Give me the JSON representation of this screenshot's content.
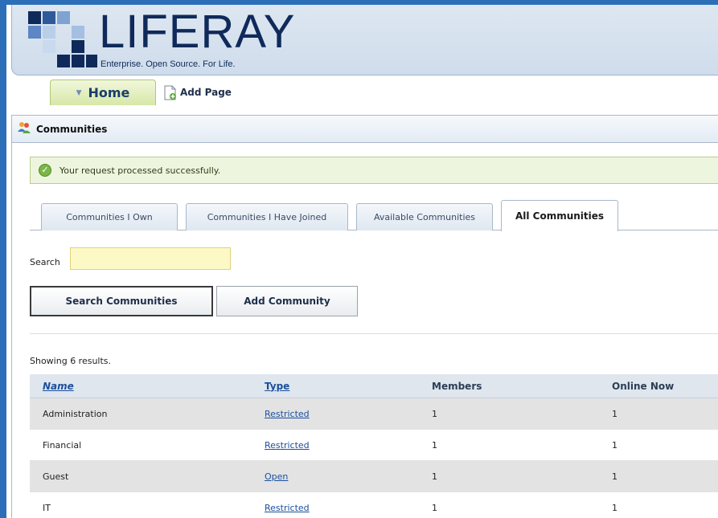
{
  "header": {
    "logo_text": "LIFERAY",
    "tagline": "Enterprise. Open Source. For Life."
  },
  "nav": {
    "home_label": "Home",
    "add_page_label": "Add Page"
  },
  "portlet": {
    "title": "Communities",
    "success_message": "Your request processed successfully."
  },
  "tabs": [
    {
      "label": "Communities I Own",
      "active": false
    },
    {
      "label": "Communities I Have Joined",
      "active": false
    },
    {
      "label": "Available Communities",
      "active": false
    },
    {
      "label": "All Communities",
      "active": true
    }
  ],
  "search": {
    "label": "Search",
    "value": "",
    "search_button": "Search Communities",
    "add_button": "Add Community"
  },
  "results": {
    "count_text": "Showing 6 results.",
    "columns": [
      "Name",
      "Type",
      "Members",
      "Online Now"
    ],
    "rows": [
      {
        "name": "Administration",
        "type": "Restricted",
        "members": "1",
        "online": "1"
      },
      {
        "name": "Financial",
        "type": "Restricted",
        "members": "1",
        "online": "1"
      },
      {
        "name": "Guest",
        "type": "Open",
        "members": "1",
        "online": "1"
      },
      {
        "name": "IT",
        "type": "Restricted",
        "members": "1",
        "online": "1"
      }
    ]
  },
  "colors": {
    "frame": "#2c6fb8",
    "brand_navy": "#0f2a5a",
    "success_bg": "#eef5df",
    "search_bg": "#fdf9c6",
    "row_alt": "#e3e3e3"
  }
}
